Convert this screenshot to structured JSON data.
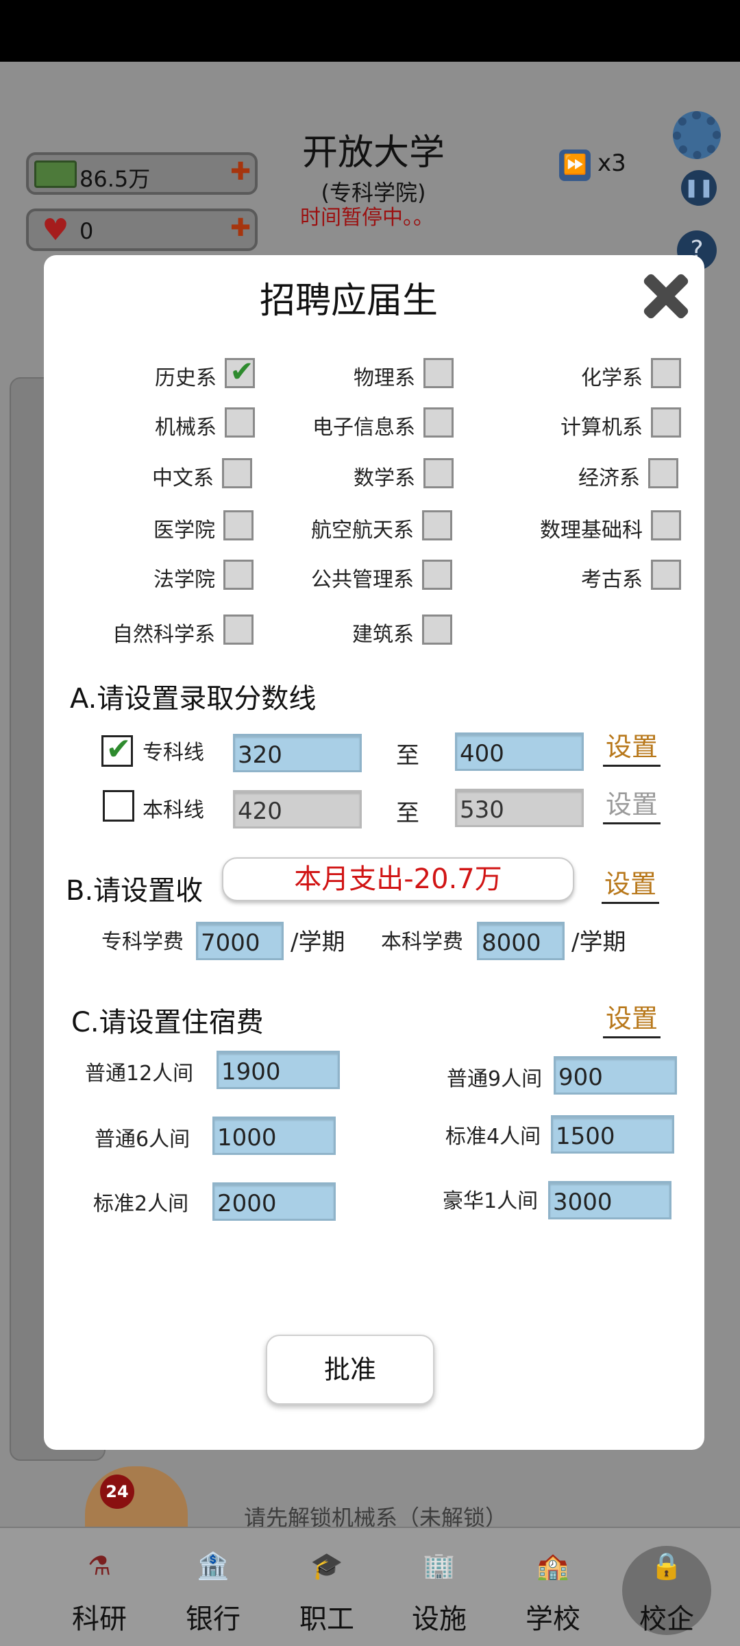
{
  "header": {
    "school_name": "开放大学",
    "school_type": "(专科学院)",
    "status": "时间暂停中。。",
    "speed": "x3",
    "money": "86.5万",
    "reputation": "0",
    "help": "?"
  },
  "background": {
    "hint": "请先解锁机械系（未解锁）",
    "support_badge": "24"
  },
  "nav": [
    {
      "label": "科研",
      "icon": "lab-flask-icon"
    },
    {
      "label": "银行",
      "icon": "bank-icon"
    },
    {
      "label": "职工",
      "icon": "graduation-cap-icon"
    },
    {
      "label": "设施",
      "icon": "buildings-icon"
    },
    {
      "label": "学校",
      "icon": "school-icon"
    },
    {
      "label": "校企",
      "icon": "locked-icon"
    }
  ],
  "modal": {
    "title": "招聘应届生",
    "departments": [
      {
        "label": "历史系",
        "checked": true
      },
      {
        "label": "物理系",
        "checked": false
      },
      {
        "label": "化学系",
        "checked": false
      },
      {
        "label": "机械系",
        "checked": false
      },
      {
        "label": "电子信息系",
        "checked": false
      },
      {
        "label": "计算机系",
        "checked": false
      },
      {
        "label": "中文系",
        "checked": false
      },
      {
        "label": "数学系",
        "checked": false
      },
      {
        "label": "经济系",
        "checked": false
      },
      {
        "label": "医学院",
        "checked": false
      },
      {
        "label": "航空航天系",
        "checked": false
      },
      {
        "label": "数理基础科",
        "checked": false
      },
      {
        "label": "法学院",
        "checked": false
      },
      {
        "label": "公共管理系",
        "checked": false
      },
      {
        "label": "考古系",
        "checked": false
      },
      {
        "label": "自然科学系",
        "checked": false
      },
      {
        "label": "建筑系",
        "checked": false
      }
    ],
    "section_a": {
      "title": "A.请设置录取分数线",
      "set_label": "设置",
      "to_label": "至",
      "zhuanke": {
        "label": "专科线",
        "min": "320",
        "max": "400",
        "checked": true
      },
      "benke": {
        "label": "本科线",
        "min": "420",
        "max": "530",
        "checked": false,
        "set_label": "设置"
      }
    },
    "section_b": {
      "title": "B.请设置收",
      "set_label": "设置",
      "toast": "本月支出-20.7万",
      "zhuanke_fee_label": "专科学费",
      "zhuanke_fee": "7000",
      "benke_fee_label": "本科学费",
      "benke_fee": "8000",
      "unit": "/学期"
    },
    "section_c": {
      "title": "C.请设置住宿费",
      "set_label": "设置",
      "rooms": [
        {
          "label": "普通12人间",
          "value": "1900"
        },
        {
          "label": "普通9人间",
          "value": "900"
        },
        {
          "label": "普通6人间",
          "value": "1000"
        },
        {
          "label": "标准4人间",
          "value": "1500"
        },
        {
          "label": "标准2人间",
          "value": "2000"
        },
        {
          "label": "豪华1人间",
          "value": "3000"
        }
      ]
    },
    "approve_label": "批准"
  },
  "colors": {
    "field_bg": "#a9cfe6",
    "field_disabled": "#cfcfcf",
    "set_link": "#b8781b",
    "toast_text": "#d11414",
    "check_green": "#2e8b2e"
  }
}
